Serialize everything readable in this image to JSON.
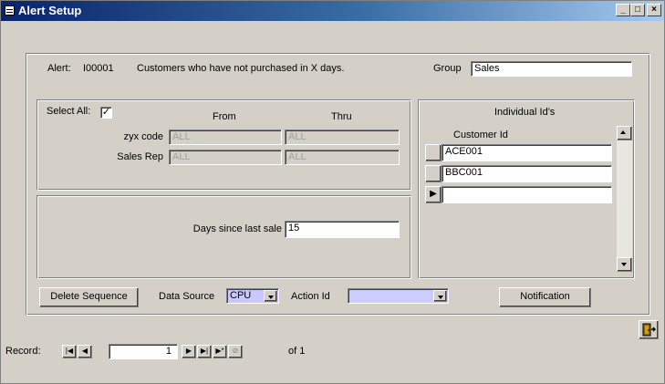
{
  "window": {
    "title": "Alert Setup",
    "minimize": "_",
    "maximize": "□",
    "close": "×"
  },
  "alert": {
    "label": "Alert:",
    "id": "I00001",
    "description": "Customers who have not purchased in X days.",
    "group_label": "Group",
    "group_value": "Sales"
  },
  "criteria": {
    "select_all_label": "Select All:",
    "select_all_checked": "✓",
    "from_header": "From",
    "thru_header": "Thru",
    "rows": [
      {
        "label": "zyx code",
        "from": "ALL",
        "thru": "ALL"
      },
      {
        "label": "Sales Rep",
        "from": "ALL",
        "thru": "ALL"
      }
    ]
  },
  "days": {
    "label": "Days since last sale",
    "value": "15"
  },
  "individual": {
    "title": "Individual Id's",
    "column_header": "Customer Id",
    "rows": [
      "ACE001",
      "BBC001",
      ""
    ],
    "current_marker": "▶"
  },
  "bottom": {
    "delete_sequence": "Delete Sequence",
    "data_source_label": "Data Source",
    "data_source_value": "CPU",
    "action_id_label": "Action Id",
    "action_id_value": "",
    "notification": "Notification"
  },
  "record_nav": {
    "label": "Record:",
    "first": "|◀",
    "prev": "◀",
    "current": "1",
    "next": "▶",
    "last": "▶|",
    "new": "▶*",
    "of_text": "of 1"
  },
  "colors": {
    "title_start": "#0a246a",
    "title_end": "#a6caf0",
    "action_field": "#ccccff",
    "face": "#d4d0c8"
  },
  "icons": {
    "exit": "exit-door-icon",
    "app": "form-icon"
  }
}
